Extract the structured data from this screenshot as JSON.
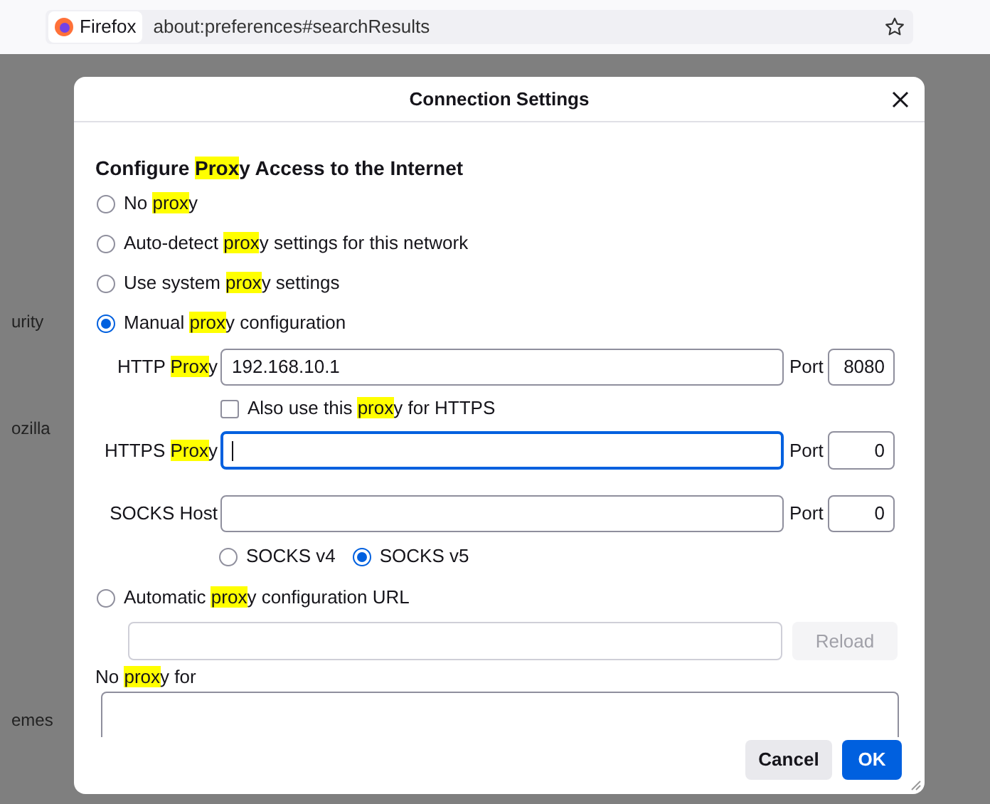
{
  "browser": {
    "identity_label": "Firefox",
    "url": "about:preferences#searchResults"
  },
  "background_text": [
    "urity",
    "ozilla",
    "emes"
  ],
  "dialog": {
    "title": "Connection Settings",
    "heading": [
      {
        "text": "Configure ",
        "highlight": false
      },
      {
        "text": "Prox",
        "highlight": true
      },
      {
        "text": "y Access to the Internet",
        "highlight": false
      }
    ],
    "proxy_modes": [
      {
        "kind": "none",
        "selected": false,
        "label": [
          {
            "text": "No ",
            "highlight": false
          },
          {
            "text": "prox",
            "highlight": true
          },
          {
            "text": "y",
            "highlight": false
          }
        ]
      },
      {
        "kind": "auto_detect",
        "selected": false,
        "label": [
          {
            "text": "Auto-detect ",
            "highlight": false
          },
          {
            "text": "prox",
            "highlight": true
          },
          {
            "text": "y settings for this network",
            "highlight": false
          }
        ]
      },
      {
        "kind": "system",
        "selected": false,
        "label": [
          {
            "text": "Use system ",
            "highlight": false
          },
          {
            "text": "prox",
            "highlight": true
          },
          {
            "text": "y settings",
            "highlight": false
          }
        ]
      },
      {
        "kind": "manual",
        "selected": true,
        "label": [
          {
            "text": "Manual ",
            "highlight": false
          },
          {
            "text": "prox",
            "highlight": true
          },
          {
            "text": "y configuration",
            "highlight": false
          }
        ]
      },
      {
        "kind": "pac",
        "selected": false,
        "label": [
          {
            "text": "Automatic ",
            "highlight": false
          },
          {
            "text": "prox",
            "highlight": true
          },
          {
            "text": "y configuration URL",
            "highlight": false
          }
        ]
      }
    ],
    "manual": {
      "http": {
        "label": [
          {
            "text": "HTTP ",
            "highlight": false
          },
          {
            "text": "Prox",
            "highlight": true
          },
          {
            "text": "y",
            "highlight": false
          }
        ],
        "value": "192.168.10.1",
        "port_label": "Port",
        "port": "8080",
        "focused": false
      },
      "also_https": {
        "label": [
          {
            "text": "Also use this ",
            "highlight": false
          },
          {
            "text": "prox",
            "highlight": true
          },
          {
            "text": "y for HTTPS",
            "highlight": false
          }
        ],
        "checked": false
      },
      "https": {
        "label": [
          {
            "text": "HTTPS ",
            "highlight": false
          },
          {
            "text": "Prox",
            "highlight": true
          },
          {
            "text": "y",
            "highlight": false
          }
        ],
        "port_label": "Port",
        "port": "0",
        "focused": true
      },
      "socks": {
        "label": [
          {
            "text": "SOCKS Host",
            "highlight": false
          }
        ],
        "port_label": "Port",
        "port": "0",
        "focused": false
      },
      "socks_versions": [
        {
          "label": "SOCKS v4",
          "selected": false
        },
        {
          "label": "SOCKS v5",
          "selected": true
        }
      ]
    },
    "pac": {
      "reload_button": {
        "label": "Reload",
        "disabled": true
      }
    },
    "no_proxy_for": {
      "label": [
        {
          "text": "No ",
          "highlight": false
        },
        {
          "text": "prox",
          "highlight": true
        },
        {
          "text": "y for",
          "highlight": false
        }
      ]
    },
    "buttons": [
      {
        "label": "Cancel",
        "kind": "secondary"
      },
      {
        "label": "OK",
        "kind": "primary"
      }
    ]
  }
}
